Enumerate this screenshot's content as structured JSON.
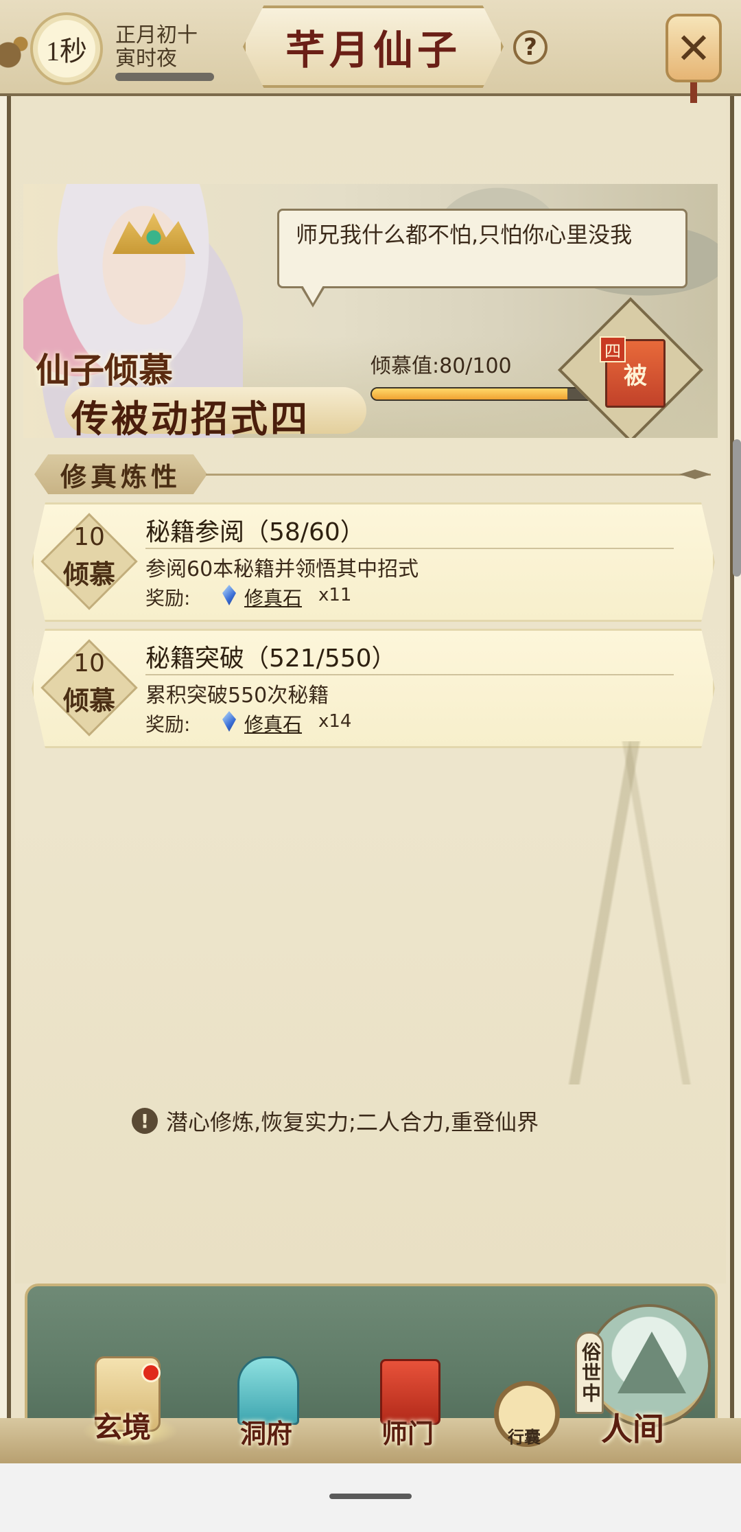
{
  "header": {
    "timer": "1秒",
    "date_line1": "正月初十",
    "date_line2": "寅时夜",
    "title": "芊月仙子",
    "help": "?",
    "close": "✕"
  },
  "banner": {
    "speech": "师兄我什么都不怕,只怕你心里没我",
    "title_line1": "仙子倾慕",
    "title_line2": "传被动招式四",
    "affection_label": "倾慕值:80/100",
    "affection_value": 80,
    "affection_max": 100,
    "book_tag": "四",
    "book_text": "被"
  },
  "section": {
    "title": "修真炼性"
  },
  "quests": [
    {
      "badge_num": "10",
      "badge_word": "倾慕",
      "title": "秘籍参阅（58/60）",
      "desc": "参阅60本秘籍并领悟其中招式",
      "reward_label": "奖励:",
      "reward_item": "修真石",
      "reward_count": "x11"
    },
    {
      "badge_num": "10",
      "badge_word": "倾慕",
      "title": "秘籍突破（521/550）",
      "desc": "累积突破550次秘籍",
      "reward_label": "奖励:",
      "reward_item": "修真石",
      "reward_count": "x14"
    }
  ],
  "hint": {
    "icon": "!",
    "text": "潜心修炼,恢复实力;二人合力,重登仙界"
  },
  "nav": {
    "items": [
      {
        "label": "玄境"
      },
      {
        "label": "洞府"
      },
      {
        "label": "师门"
      },
      {
        "label": "行囊"
      },
      {
        "label": "人间"
      }
    ],
    "world_tag": "俗世中"
  },
  "colors": {
    "title_red": "#6a1f16",
    "progress_fill": "#f0a232",
    "nav_green": "#5e7a66"
  }
}
